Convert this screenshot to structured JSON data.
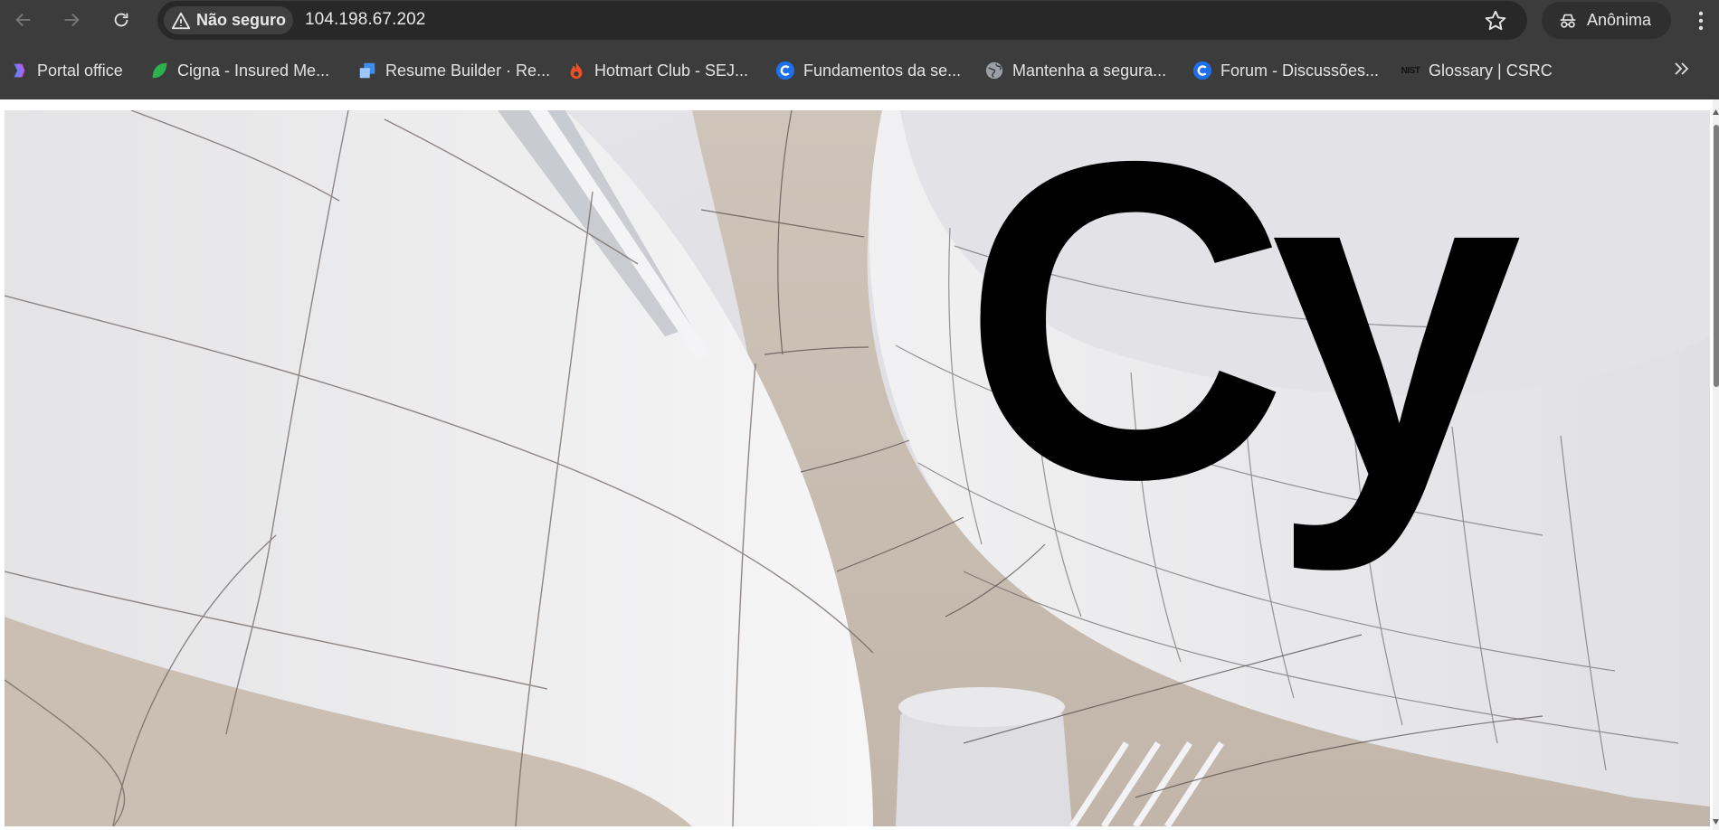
{
  "browser": {
    "security_label": "Não seguro",
    "url": "104.198.67.202",
    "profile_label": "Anônima"
  },
  "bookmarks": [
    {
      "label": "Portal office",
      "icon": "copilot-icon"
    },
    {
      "label": "Cigna - Insured Me...",
      "icon": "leaf-icon"
    },
    {
      "label": "Resume Builder · Re...",
      "icon": "resume-builder-icon"
    },
    {
      "label": "Hotmart Club - SEJ...",
      "icon": "flame-icon"
    },
    {
      "label": "Fundamentos da se...",
      "icon": "coursera-icon"
    },
    {
      "label": "Mantenha a segura...",
      "icon": "globe-icon"
    },
    {
      "label": "Forum -  Discussões...",
      "icon": "coursera-icon"
    },
    {
      "label": "Glossary | CSRC",
      "icon": "nist-icon",
      "icon_text": "NIST"
    }
  ],
  "page": {
    "hero_text": "Cy"
  },
  "colors": {
    "toolbar_bg": "#3c3c3c",
    "omnibox_bg": "#282828",
    "hero_text": "#000000"
  }
}
